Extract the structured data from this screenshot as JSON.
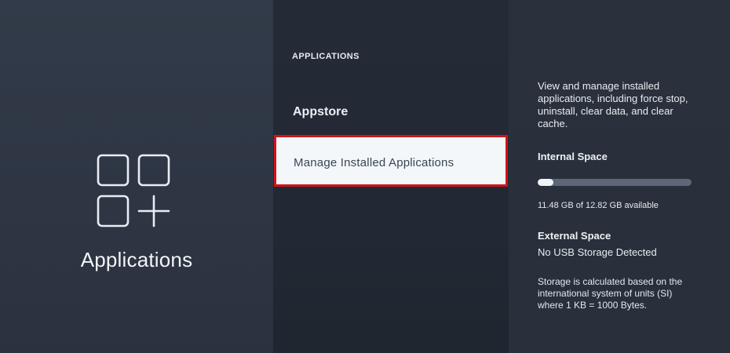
{
  "left": {
    "title": "Applications",
    "icon": "applications-grid-plus-icon"
  },
  "menu": {
    "header": "APPLICATIONS",
    "items": [
      {
        "label": "Appstore"
      },
      {
        "label": "Manage Installed Applications",
        "selected": true
      }
    ],
    "highlight_color": "#d0141b"
  },
  "info": {
    "description": "View and manage installed applications, including force stop, uninstall, clear data, and clear cache.",
    "internal_space": {
      "title": "Internal Space",
      "usage_text": "11.48 GB of 12.82 GB available",
      "used_fraction": 0.104
    },
    "external_space": {
      "title": "External Space",
      "status": "No USB Storage Detected"
    },
    "storage_note": "Storage is calculated based on the international system of units (SI) where 1 KB = 1000 Bytes."
  }
}
